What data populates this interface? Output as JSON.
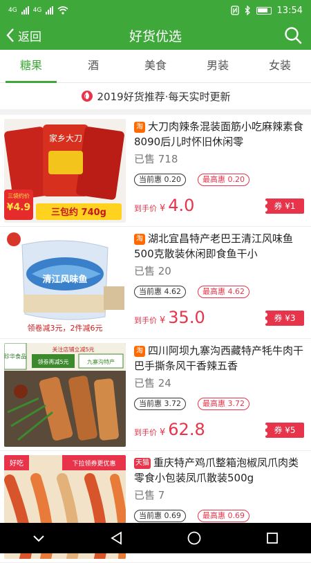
{
  "status_bar": {
    "network_1": "4G",
    "network_2": "4G",
    "time": "13:54",
    "icons": [
      "signal-icon",
      "wifi-icon",
      "nfc-icon",
      "bluetooth-icon",
      "battery-icon"
    ]
  },
  "header": {
    "back_label": "返回",
    "title": "好货优选",
    "search_icon": "search-icon"
  },
  "tabs": [
    {
      "label": "糖果",
      "active": true
    },
    {
      "label": "酒"
    },
    {
      "label": "美食"
    },
    {
      "label": "男装"
    },
    {
      "label": "女装"
    }
  ],
  "banner": {
    "icon": "fire-icon",
    "text": "2019好货推荐·每天实时更新"
  },
  "products": [
    {
      "name": "大刀肉辣条混装面筋小吃麻辣素食8090后儿时怀旧休闲零",
      "sold": "已售 718",
      "current_label": "当前惠 0.20",
      "max_label": "最高惠 0.20",
      "price_label": "到手价",
      "price_yen": "¥",
      "price": "4.0",
      "coupon": "券 ¥1",
      "thumb": {
        "top_text": "家乡大刀",
        "badge_small": "三袋约价",
        "badge_price": "¥4.9",
        "footer_text": "三包约 740g"
      }
    },
    {
      "name": "湖北宜昌特产老巴王清江风味鱼500克散装休闲即食鱼干小",
      "sold": "已售 20",
      "current_label": "当前惠 4.62",
      "max_label": "最高惠 4.62",
      "price_label": "到手价",
      "price_yen": "¥",
      "price": "35.0",
      "coupon": "券 ¥3",
      "thumb": {
        "pack_text": "清江风味鱼",
        "footer_text": "领卷减3元，2件减6元"
      }
    },
    {
      "name": "四川阿坝九寨沟西藏特产牦牛肉干巴手撕条风干香辣五香",
      "sold": "已售 24",
      "current_label": "当前惠 3.72",
      "max_label": "最高惠 3.72",
      "price_label": "到手价",
      "price_yen": "¥",
      "price": "62.8",
      "coupon": "券 ¥5",
      "thumb": {
        "corner_text": "珍华食品",
        "top_text": "关注店铺立减5元",
        "box_text": "领劵再减5元",
        "box_text2": "九寨沟特产"
      }
    },
    {
      "name": "重庆特产鸡爪整箱泡椒凤爪肉类零食小包装凤爪散装500g",
      "sold": "已售 7",
      "current_label": "当前惠 0.69",
      "max_label": "最高惠 0.69",
      "price_label": "到手价",
      "price_yen": "¥",
      "price": "",
      "coupon": "",
      "thumb": {
        "corner_text": "好吃",
        "top_text": "下拉领券更优惠"
      }
    }
  ],
  "nav_bar": {
    "icons": [
      "back-icon",
      "home-icon",
      "recents-icon"
    ]
  },
  "colors": {
    "brand": "#3fa83a",
    "accent": "#e8344a"
  }
}
